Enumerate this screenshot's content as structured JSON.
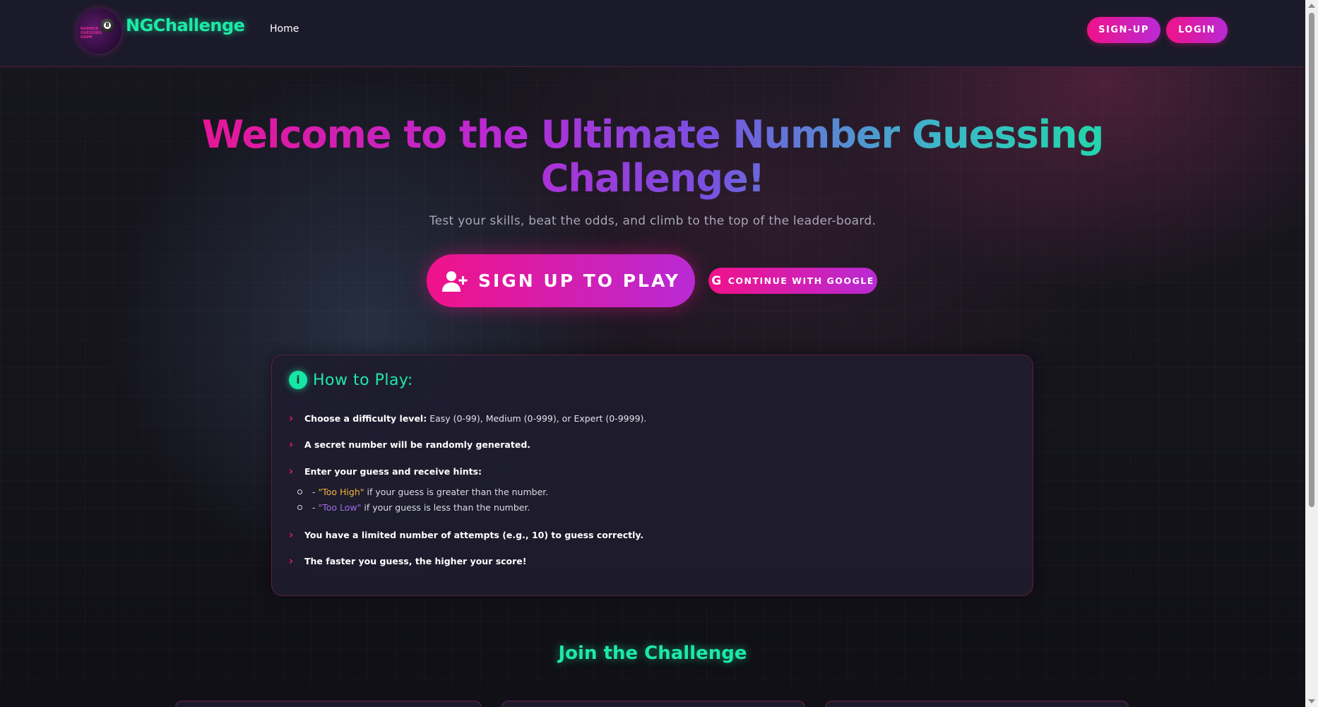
{
  "nav": {
    "brand": "NGChallenge",
    "logo_text": "NUMBER GUESSING GAME",
    "logo_ball_number": "8",
    "home_label": "Home",
    "signup_label": "SIGN-UP",
    "login_label": "LOGIN"
  },
  "hero": {
    "title": "Welcome to the Ultimate Number Guessing Challenge!",
    "subtitle": "Test your skills, beat the odds, and climb to the top of the leader-board.",
    "signup_play_label": "SIGN UP TO PLAY",
    "google_label": "CONTINUE WITH GOOGLE"
  },
  "how_to_play": {
    "title": "How to Play:",
    "rules": [
      {
        "bold": "Choose a difficulty level:",
        "plain": " Easy (0-99), Medium (0-999), or Expert (0-9999)."
      },
      {
        "bold": "A secret number will be randomly generated.",
        "plain": ""
      },
      {
        "bold": "Enter your guess and receive hints:",
        "plain": ""
      },
      {
        "bold": "You have a limited number of attempts (e.g., 10) to guess correctly.",
        "plain": ""
      },
      {
        "bold": "The faster you guess, the higher your score!",
        "plain": ""
      }
    ],
    "hints": [
      {
        "prefix": "- ",
        "tag": "\"Too High\"",
        "rest": " if your guess is greater than the number."
      },
      {
        "prefix": "- ",
        "tag": "\"Too Low\"",
        "rest": " if your guess is less than the number."
      }
    ]
  },
  "join": {
    "title": "Join the Challenge"
  },
  "colors": {
    "accent_pink": "#f0128a",
    "accent_purple": "#b92ad4",
    "accent_green": "#1de9a6",
    "too_high": "#f4b23c",
    "too_low": "#a06de8"
  },
  "icons": {
    "user_plus": "user-plus-icon",
    "google": "google-icon",
    "info": "info-icon",
    "chevron": "chevron-right-icon"
  }
}
